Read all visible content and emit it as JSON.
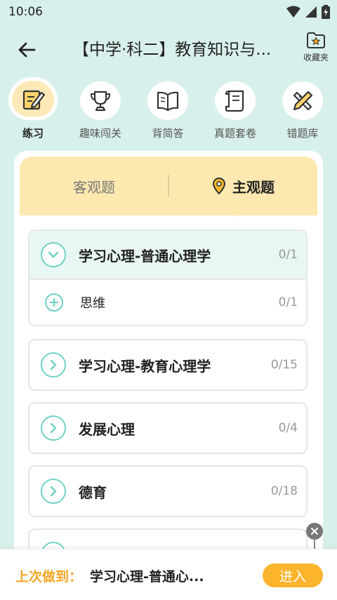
{
  "status_bar": {
    "time": "10:06"
  },
  "app_bar": {
    "title": "【中学·科二】教育知识与...",
    "favorites_label": "收藏夹"
  },
  "categories": [
    {
      "label": "练习",
      "icon": "pencil-paper-icon",
      "active": true
    },
    {
      "label": "趣味闯关",
      "icon": "trophy-icon",
      "active": false
    },
    {
      "label": "背简答",
      "icon": "book-icon",
      "active": false
    },
    {
      "label": "真题套卷",
      "icon": "scroll-icon",
      "active": false
    },
    {
      "label": "错题库",
      "icon": "pencil-ruler-icon",
      "active": false
    }
  ],
  "tabs": {
    "objective": "客观题",
    "subjective": "主观题",
    "active": "subjective"
  },
  "groups": [
    {
      "title": "学习心理-普通心理学",
      "count": "0/1",
      "expanded": true,
      "children": [
        {
          "title": "思维",
          "count": "0/1"
        }
      ]
    },
    {
      "title": "学习心理-教育心理学",
      "count": "0/15",
      "expanded": false
    },
    {
      "title": "发展心理",
      "count": "0/4",
      "expanded": false
    },
    {
      "title": "德育",
      "count": "0/18",
      "expanded": false
    }
  ],
  "bottom_bar": {
    "last_label": "上次做到：",
    "last_item": "学习心理-普通心...",
    "enter_label": "进入"
  },
  "colors": {
    "background": "#d8f0ec",
    "accent_teal": "#6fd1c4",
    "tab_yellow": "#fde9b0",
    "accent_orange": "#f5a623",
    "button_orange": "#fbb42c"
  }
}
